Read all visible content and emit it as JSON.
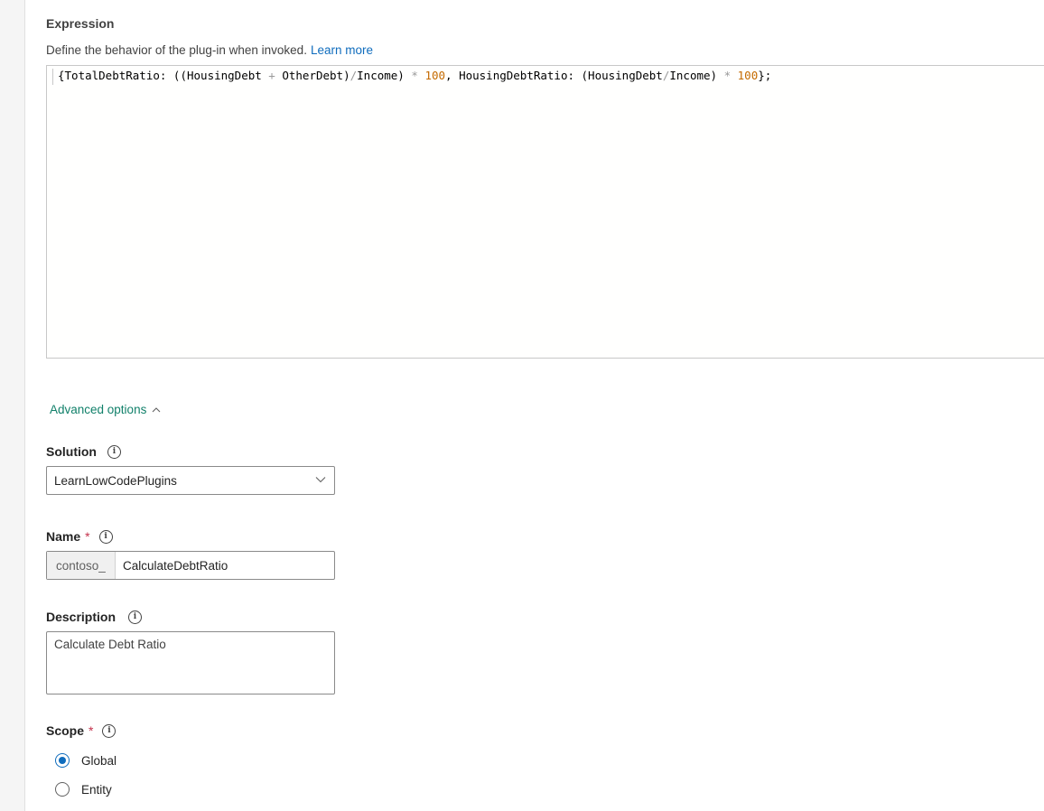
{
  "expression": {
    "title": "Expression",
    "description": "Define the behavior of the plug-in when invoked.",
    "learn_more": "Learn more",
    "code": {
      "t1": "{TotalDebtRatio: ((HousingDebt ",
      "op1": "+",
      "t2": " OtherDebt)",
      "op2": "/",
      "t3": "Income) ",
      "op3": "*",
      "t4": " ",
      "n1": "100",
      "t5": ", HousingDebtRatio: (HousingDebt",
      "op4": "/",
      "t6": "Income) ",
      "op5": "*",
      "t7": " ",
      "n2": "100",
      "t8": "};"
    }
  },
  "advanced_options": {
    "label": "Advanced options",
    "icon": "chevron-up-icon"
  },
  "solution": {
    "label": "Solution",
    "value": "LearnLowCodePlugins"
  },
  "name": {
    "label": "Name",
    "required_mark": "*",
    "prefix": "contoso_",
    "value": "CalculateDebtRatio"
  },
  "description": {
    "label": "Description",
    "value": "Calculate Debt Ratio"
  },
  "scope": {
    "label": "Scope",
    "required_mark": "*",
    "options": [
      {
        "label": "Global",
        "selected": true
      },
      {
        "label": "Entity",
        "selected": false
      }
    ]
  },
  "colors": {
    "link": "#0f6cbd",
    "toggle": "#11806a",
    "required": "#c4314b",
    "number_token": "#c46a00"
  }
}
